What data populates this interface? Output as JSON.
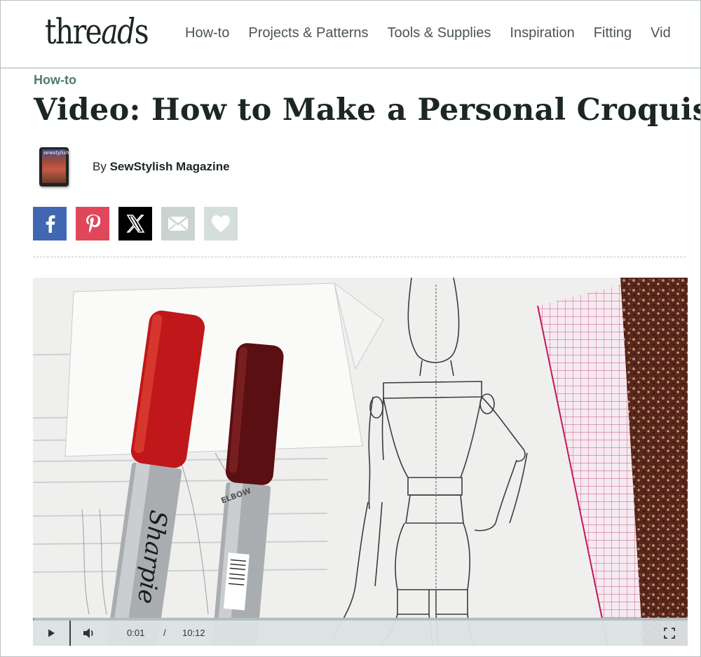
{
  "header": {
    "logo_text_start": "thre",
    "logo_text_italic": "ad",
    "logo_text_end": "s",
    "nav": [
      "How-to",
      "Projects & Patterns",
      "Tools & Supplies",
      "Inspiration",
      "Fitting",
      "Vid"
    ]
  },
  "article": {
    "category": "How-to",
    "title": "Video: How to Make a Personal Croquis",
    "byline_prefix": "By",
    "author": "SewStylish Magazine",
    "author_avatar_text": "sewstylish"
  },
  "share": {
    "buttons": [
      {
        "name": "facebook",
        "icon": "facebook-icon",
        "color": "#4267b2"
      },
      {
        "name": "pinterest",
        "icon": "pinterest-icon",
        "color": "#e1475a"
      },
      {
        "name": "x",
        "icon": "x-icon",
        "color": "#000000"
      },
      {
        "name": "email",
        "icon": "mail-icon",
        "color": "#c9d3d0"
      },
      {
        "name": "favorite",
        "icon": "heart-icon",
        "color": "#d4dfdb"
      }
    ]
  },
  "video": {
    "current_time": "0:01",
    "separator": "/",
    "duration": "10:12",
    "progress_fraction": 0.0016,
    "marker_brand": "Sharpie",
    "sketch_label": "ELBOW"
  },
  "colors": {
    "accent": "#4b7b73",
    "text": "#1c2624",
    "nav": "#4a5553"
  }
}
